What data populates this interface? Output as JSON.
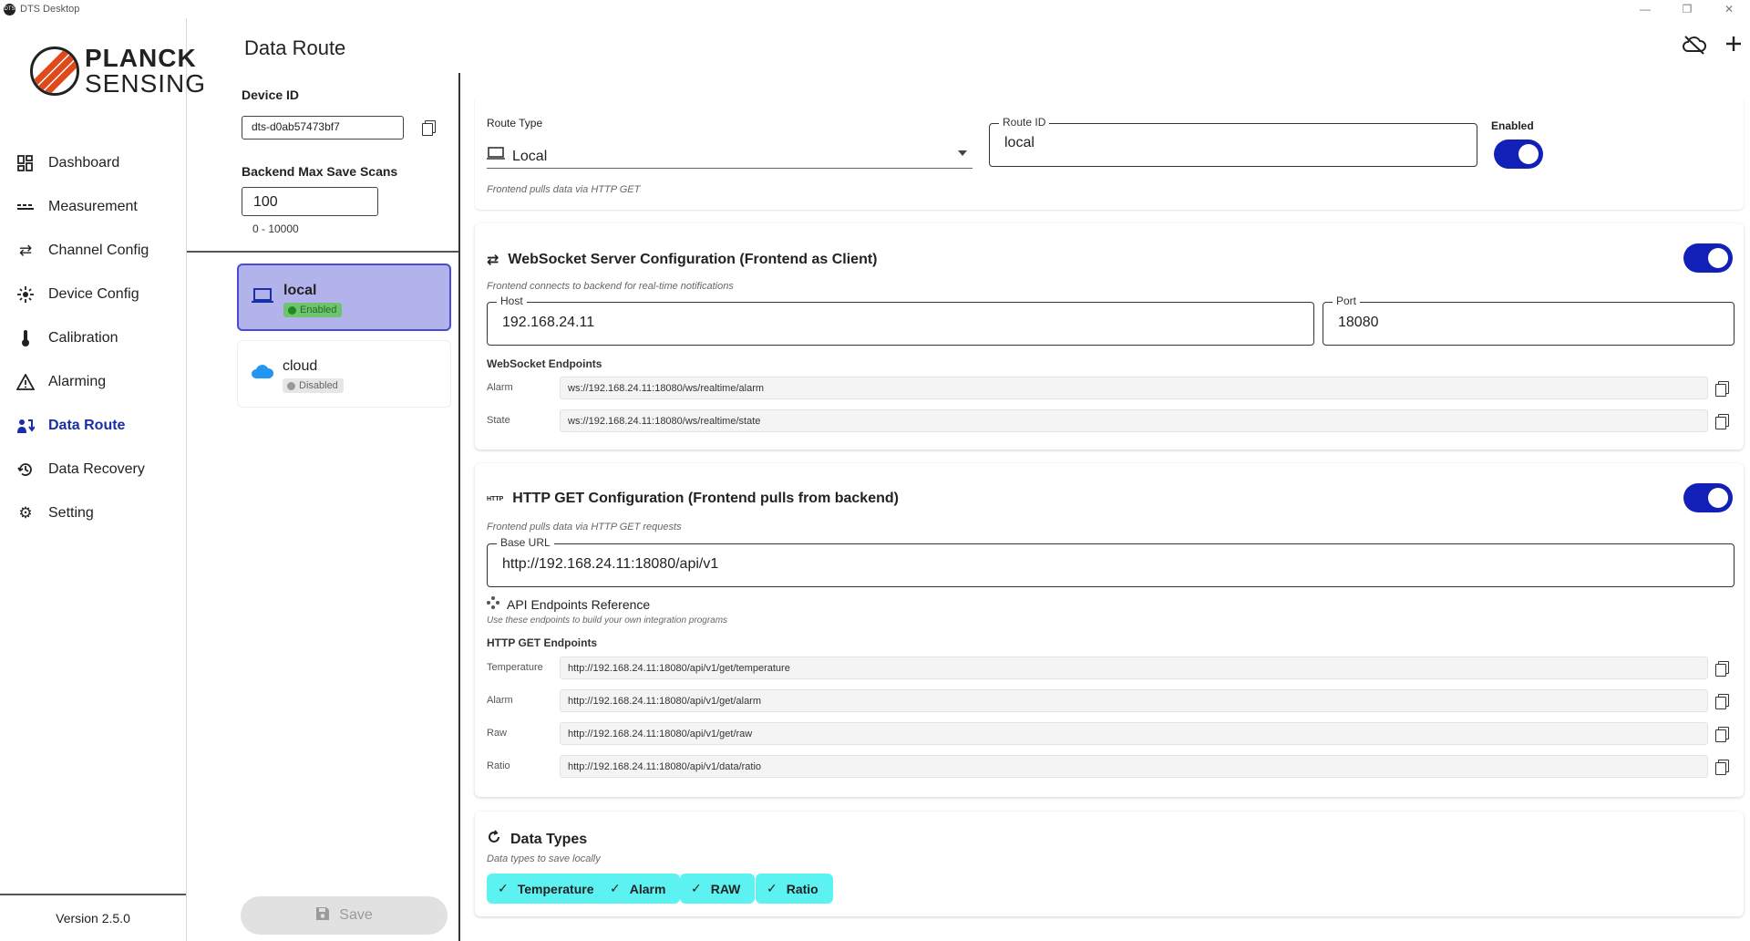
{
  "window": {
    "title": "DTS Desktop",
    "app_icon": "DTS",
    "min": "—",
    "max": "❐",
    "close": "✕"
  },
  "logo": {
    "line1": "PLANCK",
    "line2": "SENSING"
  },
  "nav": {
    "items": [
      {
        "label": "Dashboard",
        "icon": "dashboard-icon"
      },
      {
        "label": "Measurement",
        "icon": "measurement-icon"
      },
      {
        "label": "Channel Config",
        "icon": "channel-config-icon"
      },
      {
        "label": "Device Config",
        "icon": "device-config-icon"
      },
      {
        "label": "Calibration",
        "icon": "thermometer-icon"
      },
      {
        "label": "Alarming",
        "icon": "warning-icon"
      },
      {
        "label": "Data Route",
        "icon": "data-route-icon"
      },
      {
        "label": "Data Recovery",
        "icon": "history-icon"
      },
      {
        "label": "Setting",
        "icon": "gear-icon"
      }
    ],
    "active": "Data Route",
    "version": "Version 2.5.0"
  },
  "page": {
    "title": "Data Route"
  },
  "device": {
    "id_label": "Device ID",
    "id_value": "dts-d0ab57473bf7",
    "max_scans_label": "Backend Max Save Scans",
    "max_scans_value": "100",
    "max_scans_range": "0 - 10000"
  },
  "routes": [
    {
      "name": "local",
      "status": "Enabled",
      "icon": "laptop-icon"
    },
    {
      "name": "cloud",
      "status": "Disabled",
      "icon": "cloud-icon"
    }
  ],
  "save_label": "Save",
  "route_config": {
    "type_label": "Route Type",
    "type_value": "Local",
    "type_hint": "Frontend pulls data via HTTP GET",
    "id_label": "Route ID",
    "id_value": "local",
    "enabled_label": "Enabled",
    "enabled": true
  },
  "websocket": {
    "title": "WebSocket Server Configuration (Frontend as Client)",
    "subtitle": "Frontend connects to backend for real-time notifications",
    "enabled": true,
    "host_label": "Host",
    "host_value": "192.168.24.11",
    "port_label": "Port",
    "port_value": "18080",
    "endpoints_label": "WebSocket Endpoints",
    "endpoints": [
      {
        "name": "Alarm",
        "url": "ws://192.168.24.11:18080/ws/realtime/alarm"
      },
      {
        "name": "State",
        "url": "ws://192.168.24.11:18080/ws/realtime/state"
      }
    ]
  },
  "http": {
    "icon_text": "HTTP",
    "title": "HTTP GET Configuration (Frontend pulls from backend)",
    "subtitle": "Frontend pulls data via HTTP GET requests",
    "enabled": true,
    "base_url_label": "Base URL",
    "base_url_value": "http://192.168.24.11:18080/api/v1",
    "api_ref_title": "API Endpoints Reference",
    "api_ref_subtitle": "Use these endpoints to build your own integration programs",
    "endpoints_label": "HTTP GET Endpoints",
    "endpoints": [
      {
        "name": "Temperature",
        "url": "http://192.168.24.11:18080/api/v1/get/temperature"
      },
      {
        "name": "Alarm",
        "url": "http://192.168.24.11:18080/api/v1/get/alarm"
      },
      {
        "name": "Raw",
        "url": "http://192.168.24.11:18080/api/v1/get/raw"
      },
      {
        "name": "Ratio",
        "url": "http://192.168.24.11:18080/api/v1/data/ratio"
      }
    ]
  },
  "data_types": {
    "title": "Data Types",
    "subtitle": "Data types to save locally",
    "chips": [
      "Temperature",
      "Alarm",
      "RAW",
      "Ratio"
    ]
  },
  "colors": {
    "accent": "#1220b8",
    "chip": "#5df2f2",
    "selected_card": "#b3b3ec",
    "active_nav": "#1a2ea8"
  }
}
